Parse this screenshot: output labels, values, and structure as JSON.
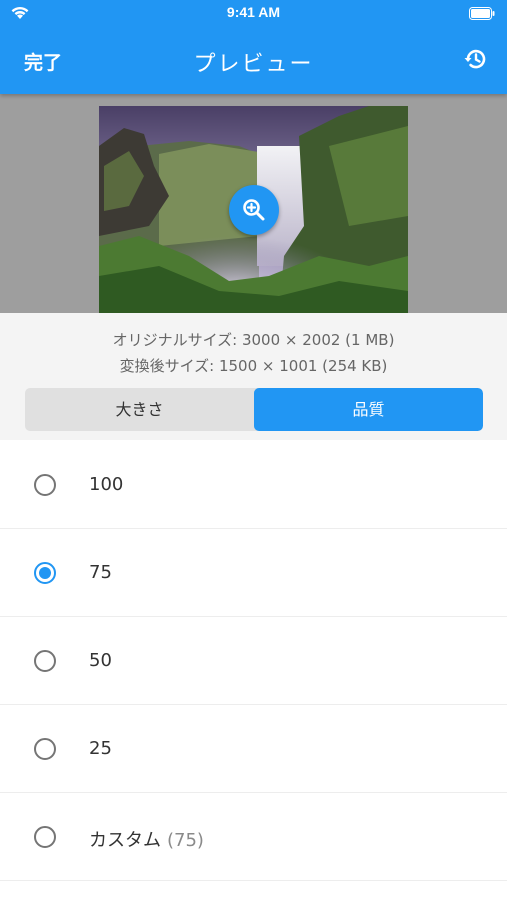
{
  "status_bar": {
    "time": "9:41 AM"
  },
  "nav": {
    "done_label": "完了",
    "title": "プレビュー",
    "history_icon": "history-icon"
  },
  "preview": {
    "zoom_icon": "zoom-in-icon",
    "accent": "#2196f3"
  },
  "info": {
    "original_size": "オリジナルサイズ: 3000 × 2002 (1 MB)",
    "converted_size": "変換後サイズ: 1500 × 1001 (254 KB)"
  },
  "tabs": [
    {
      "label": "大きさ",
      "selected": false
    },
    {
      "label": "品質",
      "selected": true
    }
  ],
  "options": [
    {
      "label": "100",
      "selected": false,
      "sub": ""
    },
    {
      "label": "75",
      "selected": true,
      "sub": ""
    },
    {
      "label": "50",
      "selected": false,
      "sub": ""
    },
    {
      "label": "25",
      "selected": false,
      "sub": ""
    },
    {
      "label": "カスタム",
      "selected": false,
      "sub": "(75)"
    }
  ]
}
